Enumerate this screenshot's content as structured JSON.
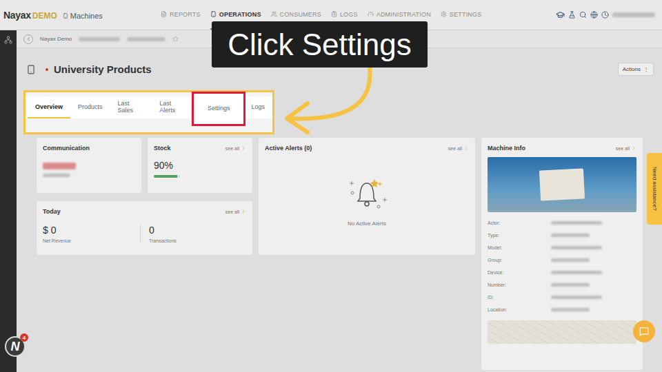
{
  "app": {
    "logo": "Nayax",
    "logo_tag": "DEMO",
    "section": "Machines"
  },
  "nav": [
    {
      "label": "REPORTS",
      "selected": false
    },
    {
      "label": "OPERATIONS",
      "selected": true
    },
    {
      "label": "CONSUMERS",
      "selected": false
    },
    {
      "label": "LOGS",
      "selected": false
    },
    {
      "label": "ADMINISTRATION",
      "selected": false
    },
    {
      "label": "SETTINGS",
      "selected": false
    }
  ],
  "breadcrumb": [
    "Nayax Demo"
  ],
  "page": {
    "title": "University Products",
    "actions": "Actions",
    "actions_glyph": "⋮"
  },
  "tabs": [
    {
      "label": "Overview",
      "selected": true
    },
    {
      "label": "Products",
      "selected": false
    },
    {
      "label": "Last Sales",
      "selected": false
    },
    {
      "label": "Last Alerts",
      "selected": false
    },
    {
      "label": "Settings",
      "selected": false
    },
    {
      "label": "Logs",
      "selected": false
    }
  ],
  "tutorial": {
    "callout": "Click Settings",
    "target": "Settings"
  },
  "cards": {
    "communication": {
      "title": "Communication"
    },
    "stock": {
      "title": "Stock",
      "link": "see all",
      "value": "90%",
      "level": 0.9
    },
    "today": {
      "title": "Today",
      "link": "see all",
      "metrics": [
        {
          "value": "$ 0",
          "label": "Net Revenue"
        },
        {
          "value": "0",
          "label": "Transactions"
        }
      ]
    },
    "alerts": {
      "title": "Active Alerts (0)",
      "link": "see all",
      "empty": "No Active Alerts"
    },
    "machine_info": {
      "title": "Machine Info",
      "link": "see all",
      "fields": [
        "Actor:",
        "Type:",
        "Model:",
        "Group:",
        "Device:",
        "Number:",
        "ID:",
        "Location:"
      ]
    }
  },
  "help_tab": "Need assistance?",
  "side_logo": "N",
  "notification_count": "4"
}
